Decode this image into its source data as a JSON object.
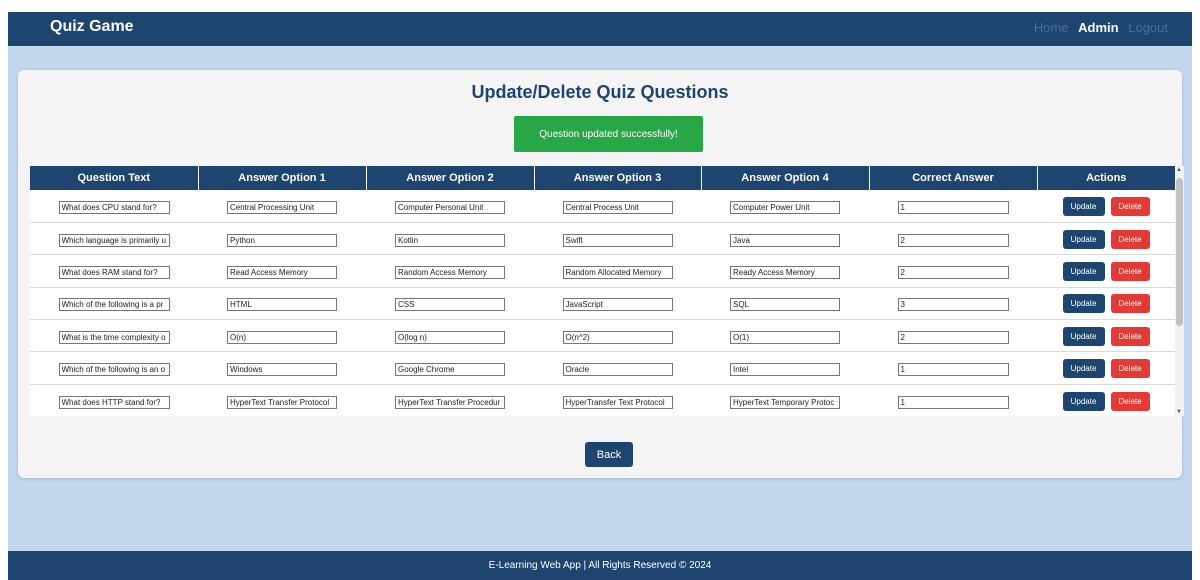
{
  "nav": {
    "brand": "Quiz Game",
    "home": "Home",
    "admin": "Admin",
    "logout": "Logout"
  },
  "page": {
    "title": "Update/Delete Quiz Questions",
    "alert": "Question updated successfully!"
  },
  "table": {
    "headers": [
      "Question Text",
      "Answer Option 1",
      "Answer Option 2",
      "Answer Option 3",
      "Answer Option 4",
      "Correct Answer",
      "Actions"
    ],
    "rows": [
      {
        "q": "What does CPU stand for?",
        "a1": "Central Processing Unit",
        "a2": "Computer Personal Unit",
        "a3": "Central Process Unit",
        "a4": "Computer Power Unit",
        "correct": "1"
      },
      {
        "q": "Which language is primarily u",
        "a1": "Python",
        "a2": "Kotlin",
        "a3": "Swift",
        "a4": "Java",
        "correct": "2"
      },
      {
        "q": "What does RAM stand for?",
        "a1": "Read Access Memory",
        "a2": "Random Access Memory",
        "a3": "Random Allocated Memory",
        "a4": "Ready Access Memory",
        "correct": "2"
      },
      {
        "q": "Which of the following is a pr",
        "a1": "HTML",
        "a2": "CSS",
        "a3": "JavaScript",
        "a4": "SQL",
        "correct": "3"
      },
      {
        "q": "What is the time complexity o",
        "a1": "O(n)",
        "a2": "O(log n)",
        "a3": "O(n^2)",
        "a4": "O(1)",
        "correct": "2"
      },
      {
        "q": "Which of the following is an o",
        "a1": "Windows",
        "a2": "Google Chrome",
        "a3": "Oracle",
        "a4": "Intel",
        "correct": "1"
      },
      {
        "q": "What does HTTP stand for?",
        "a1": "HyperText Transfer Protocol",
        "a2": "HyperText Transfer Procedur",
        "a3": "HyperTransfer Text Protocol",
        "a4": "HyperText Temporary Protoc",
        "correct": "1"
      }
    ],
    "update_label": "Update",
    "delete_label": "Delete"
  },
  "back_label": "Back",
  "footer": "E-Learning Web App | All Rights Reserved © 2024",
  "colors": {
    "primary": "#1d4570",
    "background": "#c3d7ee",
    "success": "#27a745",
    "danger": "#e53935"
  },
  "icons": {
    "scroll_up": "triangle-up-icon",
    "scroll_down": "triangle-down-icon"
  }
}
